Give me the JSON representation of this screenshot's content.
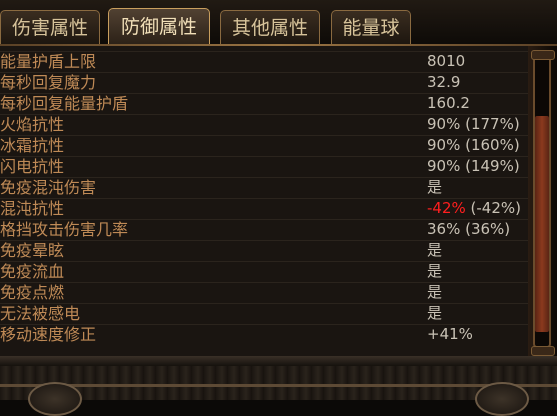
{
  "tabs": [
    {
      "label": "伤害属性",
      "active": false
    },
    {
      "label": "防御属性",
      "active": true
    },
    {
      "label": "其他属性",
      "active": false
    },
    {
      "label": "能量球",
      "active": false
    }
  ],
  "stats": [
    {
      "label": "能量护盾上限",
      "value": "8010"
    },
    {
      "label": "每秒回复魔力",
      "value": "32.9"
    },
    {
      "label": "每秒回复能量护盾",
      "value": "160.2"
    },
    {
      "label": "火焰抗性",
      "value": "90% (177%)"
    },
    {
      "label": "冰霜抗性",
      "value": "90% (160%)"
    },
    {
      "label": "闪电抗性",
      "value": "90% (149%)"
    },
    {
      "label": "免疫混沌伤害",
      "value": "是"
    },
    {
      "label": "混沌抗性",
      "value_negative": "-42%",
      "value_rest": " (-42%)"
    },
    {
      "label": "格挡攻击伤害几率",
      "value": "36% (36%)"
    },
    {
      "label": "免疫晕眩",
      "value": "是"
    },
    {
      "label": "免疫流血",
      "value": "是"
    },
    {
      "label": "免疫点燃",
      "value": "是"
    },
    {
      "label": "无法被感电",
      "value": "是"
    },
    {
      "label": "移动速度修正",
      "value": "+41%"
    }
  ],
  "colors": {
    "label": "#bf8a56",
    "value": "#c9c2b5",
    "negative": "#ff1f1f",
    "accent_border": "#c99f5e"
  }
}
